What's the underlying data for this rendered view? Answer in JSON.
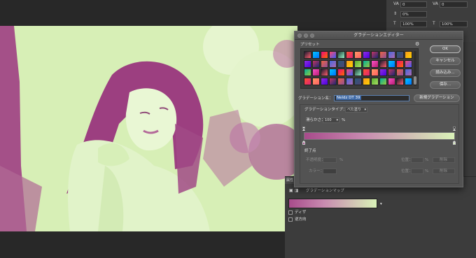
{
  "character_panel": {
    "fields": [
      "0",
      "0",
      "0%",
      "100%",
      "100%"
    ],
    "va_icon": "VA",
    "t_icon": "T"
  },
  "dialog": {
    "title": "グラデーションエディター",
    "preset_label": "プリセット",
    "preset_menu_icon": "gear-icon",
    "buttons": {
      "ok": "OK",
      "cancel": "キャンセル",
      "load": "読み込み...",
      "save": "保存...",
      "new_gradient": "新規グラデーション"
    },
    "name_label": "グラデーション名：",
    "name_value": "Neldz DT 39",
    "gradient_type_label": "グラデーションタイプ：",
    "gradient_type_value": "べた塗り",
    "smoothness_label": "滑らかさ：",
    "smoothness_value": "100",
    "smoothness_unit": "%",
    "stops_label": "終了点",
    "opacity_label": "不透明度：",
    "opacity_unit": "%",
    "location_label": "位置：",
    "location_unit": "%",
    "delete_label": "削除",
    "color_label": "カラー：",
    "location2_label": "位置：",
    "location2_unit": "%",
    "delete2_label": "削除"
  },
  "gradient": {
    "start_color": "#a84b8b",
    "end_color": "#d9f2b8"
  },
  "properties": {
    "tab_label": "属性",
    "adjustment_label": "グラデーションマップ",
    "dither_label": "ディザ",
    "reverse_label": "逆方向"
  }
}
